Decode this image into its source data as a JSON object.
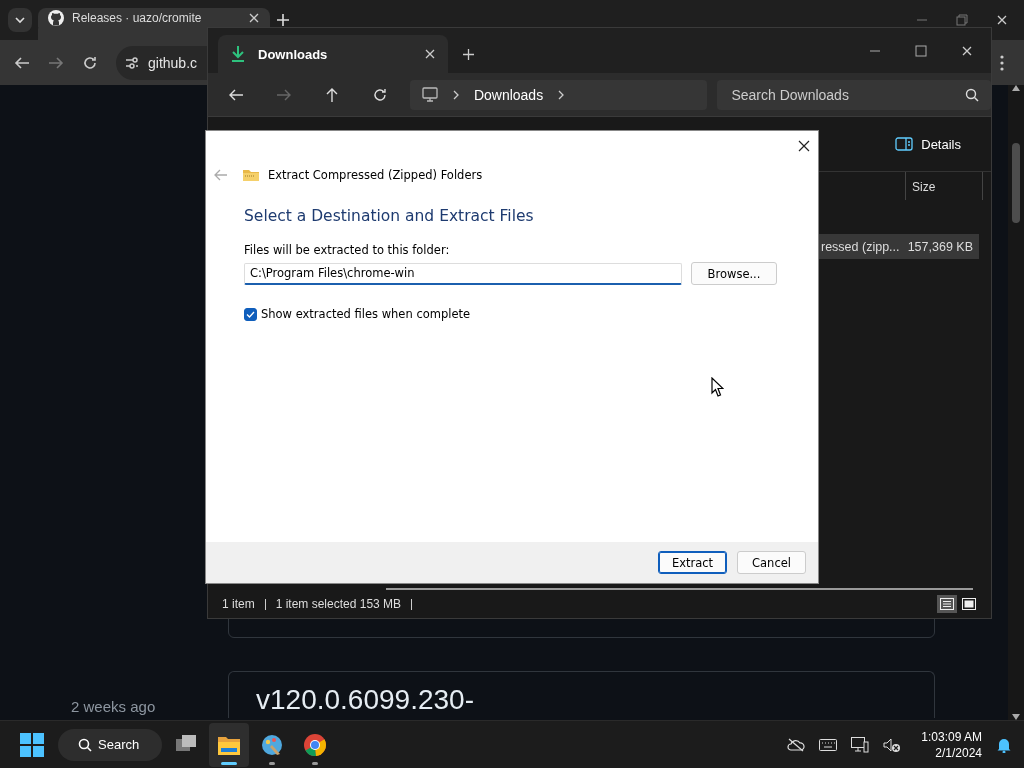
{
  "browser": {
    "tabs": [
      {
        "title": "Releases · uazo/cromite",
        "selected": true
      }
    ],
    "address": "github.c",
    "page": {
      "time_label": "2 weeks ago",
      "release_heading": "v120.0.6099.230-"
    }
  },
  "explorer": {
    "tabs": [
      {
        "title": "Downloads",
        "selected": true
      }
    ],
    "breadcrumb": [
      "Downloads"
    ],
    "search": {
      "placeholder": "Search Downloads"
    },
    "view_button": "Details",
    "columns": [
      "Size"
    ],
    "rows": [
      {
        "type": "ressed (zipp...",
        "size": "157,369 KB",
        "selected": true
      }
    ],
    "status": {
      "items": "1 item",
      "selection": "1 item selected  153 MB"
    },
    "views": [
      {
        "kind": "details",
        "selected": true
      },
      {
        "kind": "tiles",
        "selected": false
      }
    ]
  },
  "dialog": {
    "title": "Extract Compressed (Zipped) Folders",
    "heading": "Select a Destination and Extract Files",
    "field_label": "Files will be extracted to this folder:",
    "path": "C:\\Program Files\\chrome-win",
    "browse": "Browse...",
    "show_files": {
      "label": "Show extracted files when complete",
      "checked": true
    },
    "buttons": [
      {
        "label": "Extract",
        "default": true
      },
      {
        "label": "Cancel",
        "default": false
      }
    ]
  },
  "taskbar": {
    "search": "Search",
    "apps": [
      {
        "kind": "taskview",
        "active": false,
        "running": false
      },
      {
        "kind": "explorer",
        "active": true,
        "running": true
      },
      {
        "kind": "paint",
        "active": false,
        "running": true
      },
      {
        "kind": "chrome",
        "active": false,
        "running": true
      }
    ],
    "time": "1:03:09 AM",
    "date": "2/1/2024"
  }
}
